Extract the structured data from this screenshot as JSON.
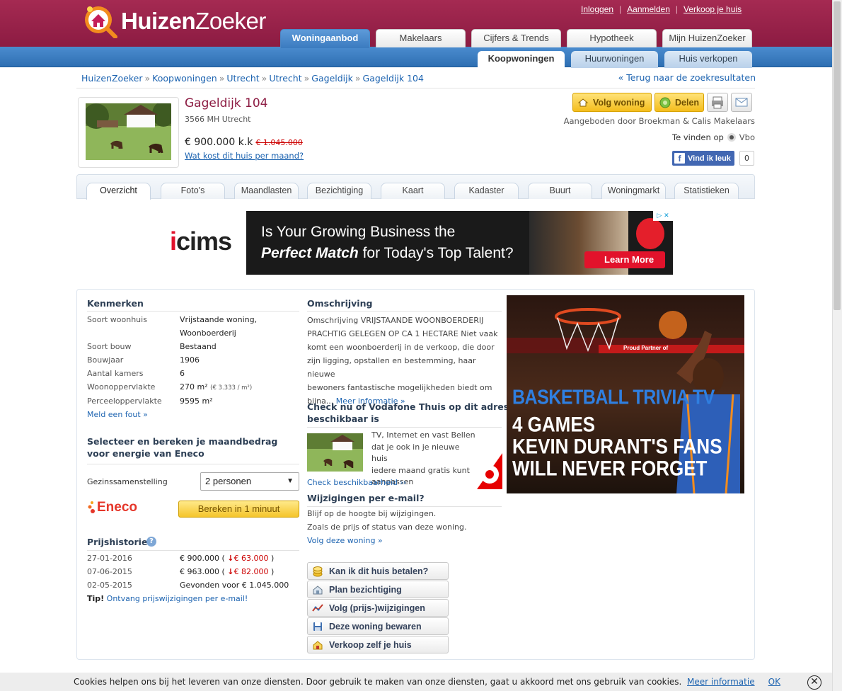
{
  "brand": {
    "name_bold": "Huizen",
    "name_light": "Zoeker"
  },
  "top_links": [
    "Inloggen",
    "Aanmelden",
    "Verkoop je huis"
  ],
  "main_tabs": [
    "Woningaanbod",
    "Makelaars",
    "Cijfers & Trends",
    "Hypotheek",
    "Mijn HuizenZoeker"
  ],
  "sub_tabs": [
    "Koopwoningen",
    "Huurwoningen",
    "Huis verkopen"
  ],
  "breadcrumb": [
    "HuizenZoeker",
    "Koopwoningen",
    "Utrecht",
    "Utrecht",
    "Gageldijk",
    "Gageldijk 104"
  ],
  "breadcrumb_sep": "»",
  "back_link": "« Terug naar de zoekresultaten",
  "property": {
    "title": "Gageldijk 104",
    "address": "3566 MH Utrecht",
    "price": "€ 900.000",
    "price_suffix": "k.k",
    "old_price": "€ 1.045.000",
    "monthly_link": "Wat kost dit huis per maand?"
  },
  "actions": {
    "follow": "Volg woning",
    "share": "Delen"
  },
  "offered_by": {
    "prefix": "Aangeboden door",
    "agent": "Broekman & Calis Makelaars"
  },
  "found_on": {
    "prefix": "Te vinden op",
    "site": "Vbo"
  },
  "facebook": {
    "label": "Vind ik leuk",
    "count": "0"
  },
  "detail_tabs": [
    "Overzicht",
    "Foto's",
    "Maandlasten",
    "Bezichtiging",
    "Kaart",
    "Kadaster",
    "Buurt",
    "Woningmarkt",
    "Statistieken"
  ],
  "ad_banner": {
    "brand": "icims",
    "line1": "Is Your Growing Business the",
    "line2_bold": "Perfect Match",
    "line2_rest": "for Today's Top Talent?",
    "cta": "Learn More"
  },
  "kenmerken": {
    "title": "Kenmerken",
    "rows": [
      {
        "label": "Soort woonhuis",
        "value": "Vrijstaande woning,"
      },
      {
        "label": "",
        "value": "Woonboerderij"
      },
      {
        "label": "Soort bouw",
        "value": "Bestaand"
      },
      {
        "label": "Bouwjaar",
        "value": "1906"
      },
      {
        "label": "Aantal kamers",
        "value": "6"
      },
      {
        "label": "Woonoppervlakte",
        "value": "270 m²"
      },
      {
        "label": "Perceeloppervlakte",
        "value": "9595 m²"
      }
    ],
    "m2_price": "(€ 3.333 / m²)",
    "report_link": "Meld een fout »"
  },
  "energy": {
    "title_line1": "Selecteer en bereken je maandbedrag",
    "title_line2": "voor energie van Eneco",
    "household_label": "Gezinssamenstelling",
    "household_value": "2 personen",
    "brand": "Eneco",
    "button": "Bereken in 1 minuut"
  },
  "price_history": {
    "title": "Prijshistorie",
    "rows": [
      {
        "date": "27-01-2016",
        "price": "€ 900.000",
        "delta": "€ 63.000"
      },
      {
        "date": "07-06-2015",
        "price": "€ 963.000",
        "delta": "€ 82.000"
      },
      {
        "date": "02-05-2015",
        "price": "Gevonden voor € 1.045.000",
        "delta": ""
      }
    ],
    "tip_label": "Tip!",
    "tip_link": "Ontvang prijswijzigingen per e-mail!"
  },
  "description": {
    "title": "Omschrijving",
    "lines": [
      "Omschrijving VRIJSTAANDE WOONBOERDERIJ",
      "PRACHTIG GELEGEN OP CA 1 HECTARE Niet vaak",
      "komt een woonboerderij in de verkoop, die door",
      "zijn ligging, opstallen en bestemming, haar nieuwe",
      "bewoners fantastische mogelijkheden biedt om",
      "bijna..."
    ],
    "more_link": "Meer informatie »"
  },
  "vodafone": {
    "title_line1": "Check nu of Vodafone Thuis op dit adres",
    "title_line2": "beschikbaar is",
    "lines": [
      "TV, Internet en vast Bellen",
      "dat je ook in je nieuwe huis",
      "iedere maand gratis kunt",
      "aanpassen"
    ],
    "link": "Check beschikbaarheid ››"
  },
  "email_updates": {
    "title": "Wijzigingen per e-mail?",
    "lines": [
      "Blijf op de hoogte bij wijzigingen.",
      "Zoals de prijs of status van deze woning."
    ],
    "link": "Volg deze woning »"
  },
  "action_buttons": [
    "Kan ik dit huis betalen?",
    "Plan bezichtiging",
    "Volg (prijs-)wijzigingen",
    "Deze woning bewaren",
    "Verkoop zelf je huis"
  ],
  "tv_ad": {
    "line1": "BASKETBALL TRIVIA TV",
    "line2": "4 GAMES",
    "line3": "KEVIN DURANT'S FANS",
    "line4": "WILL NEVER FORGET",
    "banner": "Proud Partner of"
  },
  "cookie": {
    "text": "Cookies helpen ons bij het leveren van onze diensten. Door gebruik te maken van onze diensten, gaat u akkoord met ons gebruik van cookies.",
    "more": "Meer informatie",
    "ok": "OK",
    "close": "✕"
  },
  "colors": {
    "brand": "#8c1b42",
    "nav_blue": "#3b7bc0",
    "link": "#1c63b0",
    "button_yellow": "#f5c52b"
  }
}
